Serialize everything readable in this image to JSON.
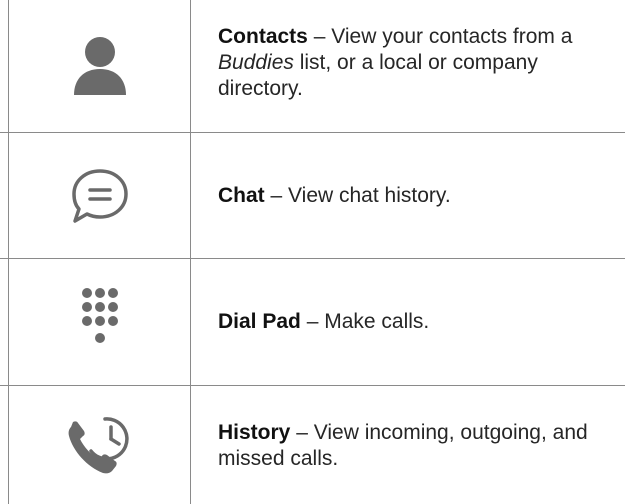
{
  "rows": [
    {
      "icon": "person-icon",
      "term": "Contacts",
      "sep": " – ",
      "desc_before": "View your contacts from a ",
      "desc_em": "Buddies",
      "desc_after": " list, or a local or company directory."
    },
    {
      "icon": "chat-bubble-icon",
      "term": "Chat",
      "sep": " – ",
      "desc": "View chat history."
    },
    {
      "icon": "dial-pad-icon",
      "term": "Dial Pad",
      "sep": " – ",
      "desc": "Make calls."
    },
    {
      "icon": "call-history-icon",
      "term": "History",
      "sep": " – ",
      "desc": "View incoming, outgoing, and missed calls."
    }
  ],
  "colors": {
    "icon": "#6a6a6a",
    "border": "#8a8a8a",
    "text": "#262626"
  }
}
